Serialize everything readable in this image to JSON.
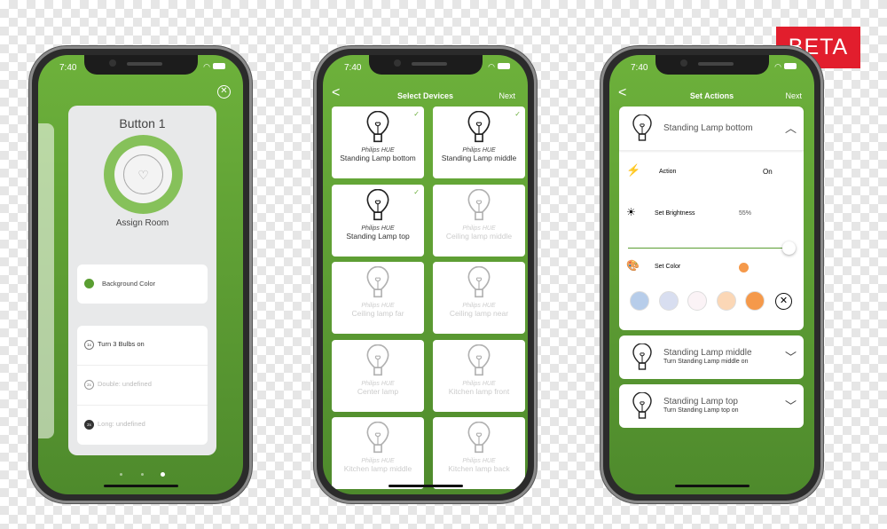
{
  "beta_label": "BETA",
  "status_time": "7:40",
  "phone1": {
    "title": "Button 1",
    "assign_room": "Assign Room",
    "background_color": "Background Color",
    "background_color_value": "#5a9e32",
    "actions": [
      {
        "badge": "1x",
        "label": "Turn 3 Bulbs on"
      },
      {
        "badge": "2x",
        "label": "Double: undefined"
      },
      {
        "badge": "2x",
        "label": "Long: undefined"
      }
    ],
    "page_dots": 3,
    "active_page": 3
  },
  "phone2": {
    "title": "Select Devices",
    "back": "<",
    "next": "Next",
    "devices": [
      {
        "brand": "Philips HUE",
        "name": "Standing Lamp bottom",
        "selected": true
      },
      {
        "brand": "Philips HUE",
        "name": "Standing Lamp middle",
        "selected": true
      },
      {
        "brand": "Philips HUE",
        "name": "Standing Lamp top",
        "selected": true
      },
      {
        "brand": "Philips HUE",
        "name": "Ceiling lamp middle",
        "selected": false
      },
      {
        "brand": "Philips HUE",
        "name": "Ceiling lamp far",
        "selected": false
      },
      {
        "brand": "Philips HUE",
        "name": "Ceiling lamp near",
        "selected": false
      },
      {
        "brand": "Philips HUE",
        "name": "Center lamp",
        "selected": false
      },
      {
        "brand": "Philips HUE",
        "name": "Kitchen lamp front",
        "selected": false
      },
      {
        "brand": "Philips HUE",
        "name": "Kitchen lamp middle",
        "selected": false
      },
      {
        "brand": "Philips HUE",
        "name": "Kitchen lamp back",
        "selected": false
      }
    ]
  },
  "phone3": {
    "title": "Set Actions",
    "back": "<",
    "next": "Next",
    "expanded": {
      "name": "Standing Lamp bottom",
      "action_label": "Action",
      "action_value": "On",
      "brightness_label": "Set Brightness",
      "brightness_value": "55%",
      "color_label": "Set Color",
      "selected_color": "#f5994a",
      "swatches": [
        "#b7cdea",
        "#d8def0",
        "#fbf3f6",
        "#fbd7b6",
        "#f5994a"
      ]
    },
    "collapsed": [
      {
        "name": "Standing Lamp middle",
        "sub": "Turn Standing Lamp middle on"
      },
      {
        "name": "Standing Lamp top",
        "sub": "Turn Standing Lamp top on"
      }
    ]
  }
}
